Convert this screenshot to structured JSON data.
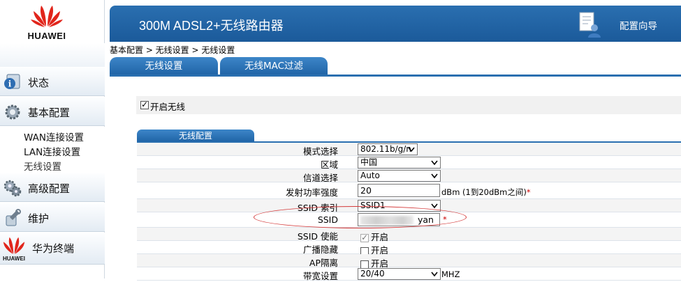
{
  "brand": {
    "logo_text": "HUAWEI",
    "color": "#e1251b"
  },
  "header": {
    "title": "300M ADSL2+无线路由器",
    "wizard_label": "配置向导"
  },
  "breadcrumb": "基本配置 > 无线设置 > 无线设置",
  "tabs": [
    {
      "label": "无线设置",
      "active": true
    },
    {
      "label": "无线MAC过滤",
      "active": false
    }
  ],
  "sidebar": {
    "items": [
      {
        "label": "状态",
        "icon": "status-info-icon"
      },
      {
        "label": "基本配置",
        "icon": "gear-icon"
      },
      {
        "label": "高级配置",
        "icon": "advanced-gears-icon"
      },
      {
        "label": "维护",
        "icon": "wrench-icon"
      },
      {
        "label": "华为终端",
        "icon": "huawei-logo-icon"
      }
    ],
    "sub_items": [
      {
        "label": "WAN连接设置"
      },
      {
        "label": "LAN连接设置"
      },
      {
        "label": "无线设置",
        "active": true
      }
    ],
    "footer_logo_text": "HUAWEI"
  },
  "enable_wireless": {
    "label": "开启无线",
    "checked": true
  },
  "section_title": "无线配置",
  "form": {
    "mode": {
      "label": "模式选择",
      "value": "802.11b/g/n"
    },
    "region": {
      "label": "区域",
      "value": "中国"
    },
    "channel": {
      "label": "信道选择",
      "value": "Auto"
    },
    "power": {
      "label": "发射功率强度",
      "value": "20",
      "hint": "dBm (1到20dBm之间)",
      "required": "*"
    },
    "ssid_index": {
      "label": "SSID 索引",
      "value": "SSID1"
    },
    "ssid": {
      "label": "SSID",
      "value": "yan",
      "required": "*"
    },
    "ssid_enable": {
      "label": "SSID 使能",
      "option": "开启",
      "checked": true
    },
    "broadcast_hide": {
      "label": "广播隐藏",
      "option": "开启",
      "checked": false
    },
    "ap_isolation": {
      "label": "AP隔离",
      "option": "开启",
      "checked": false
    },
    "bandwidth": {
      "label": "带宽设置",
      "value": "20/40",
      "unit": "MHZ"
    }
  },
  "colors": {
    "header_blue": "#1f63a6",
    "annotation_red": "#d43a3a"
  }
}
